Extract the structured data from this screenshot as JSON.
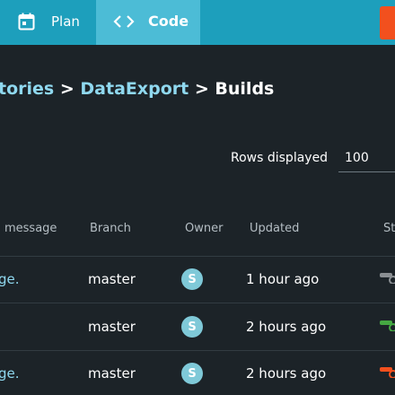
{
  "nav": {
    "plan_label": "Plan",
    "code_label": "Code"
  },
  "breadcrumb": {
    "parent": "tories",
    "separator_1": ">",
    "repo": "DataExport",
    "separator_2": ">",
    "current": "Builds"
  },
  "rows_displayed": {
    "label": "Rows displayed",
    "value": "100"
  },
  "table": {
    "headers": {
      "message": "message",
      "branch": "Branch",
      "owner": "Owner",
      "updated": "Updated",
      "status": "St"
    },
    "rows": [
      {
        "message": "ge.",
        "branch": "master",
        "owner_initial": "S",
        "updated": "1 hour ago",
        "status_color": "#8a8f93"
      },
      {
        "message": "",
        "branch": "master",
        "owner_initial": "S",
        "updated": "2 hours ago",
        "status_color": "#45a842"
      },
      {
        "message": "ge.",
        "branch": "master",
        "owner_initial": "S",
        "updated": "2 hours ago",
        "status_color": "#f2501e"
      }
    ]
  },
  "colors": {
    "topbar": "#1d9fbc",
    "active_tab": "#4cbcd6",
    "accent_orange": "#f2501e",
    "link": "#8fd8ef",
    "background": "#1c2328"
  }
}
